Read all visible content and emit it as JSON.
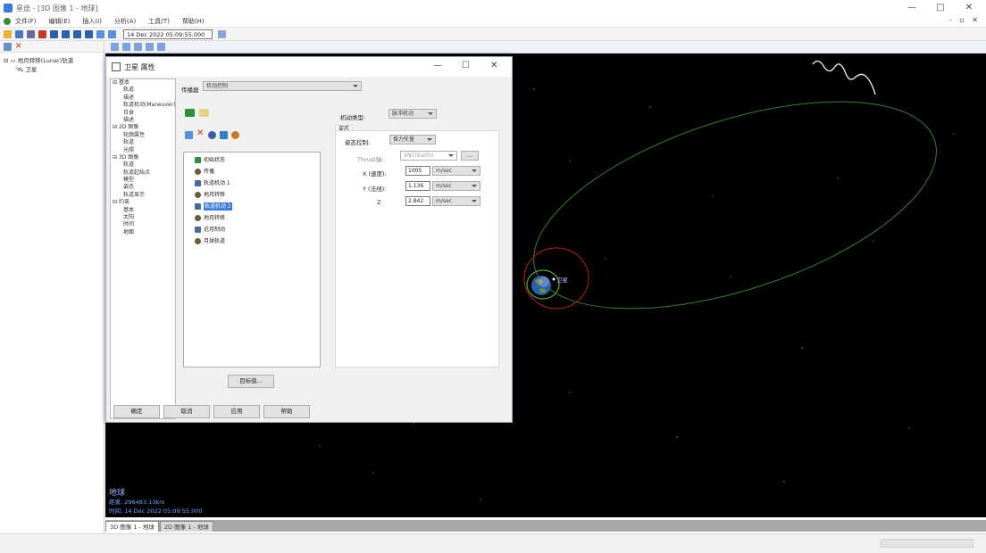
{
  "window": {
    "title": "星途 - [3D 图像 1 - 地球]",
    "minimize": "—",
    "maximize": "□",
    "close": "✕",
    "mdi_controls": "- ▫ ✕"
  },
  "menu": [
    "文件(F)",
    "编辑(E)",
    "插入(I)",
    "分析(A)",
    "工具(T)",
    "帮助(H)"
  ],
  "toolbar": {
    "datetime": "14 Dec 2022 05:09:55.000"
  },
  "left_tree": {
    "root": "地月转移(Lunar)轨道",
    "child": "卫星"
  },
  "dialog": {
    "title": "卫星 属性",
    "minimize": "—",
    "maximize": "☐",
    "close": "✕",
    "tree": [
      "基本",
      "轨道",
      "描述",
      "轨道机动(Maneuver)",
      "日食",
      "描述",
      "2D 图像",
      "轮廓属性",
      "轨道",
      "光照",
      "3D 图像",
      "轨道",
      "轨道起始点",
      "模型",
      "姿态",
      "轨道显示",
      "约束",
      "基本",
      "太阳",
      "时间",
      "地面"
    ],
    "hscroll_left": "‹",
    "hscroll_right": "›",
    "propagator_label": "传播器",
    "propagator_value": "机动控制",
    "segments": [
      "初始状态",
      "传播",
      "轨道机动 1",
      "地月转移",
      "轨道机动 2",
      "地月转移",
      "近月制动",
      "月球轨道"
    ],
    "maneuver_type_label": "机动类型:",
    "maneuver_type_value": "脉冲机动",
    "tab_label": "姿态",
    "attitude_label": "姿态控制:",
    "attitude_value": "推力矢量",
    "thrust_label": "Thrust轴:",
    "thrust_value": "VNC(Earth)",
    "x_label": "X (速度):",
    "x_value": "1005",
    "x_unit": "m/sec",
    "y_label": "Y (法线):",
    "y_value": "1.136",
    "y_unit": "m/sec",
    "z_label": "Z",
    "z_value": "2.842",
    "z_unit": "m/sec",
    "target_button": "目标值...",
    "buttons": {
      "ok": "确定",
      "cancel": "取消",
      "apply": "应用",
      "help": "帮助"
    }
  },
  "space": {
    "object_label": "卫星",
    "info_name": "地球",
    "info_distance": "距离: 296483.13km",
    "info_time": "时间: 14 Dec 2022 05:09:55.000"
  },
  "tabs": [
    "3D 图像 1 - 地球",
    "2D 图像 1 - 地球"
  ],
  "colors": {
    "space": "#000000",
    "orbit_green": "#3e7a2a",
    "orbit_red": "#b22222",
    "selection": "#3a7bd5"
  }
}
